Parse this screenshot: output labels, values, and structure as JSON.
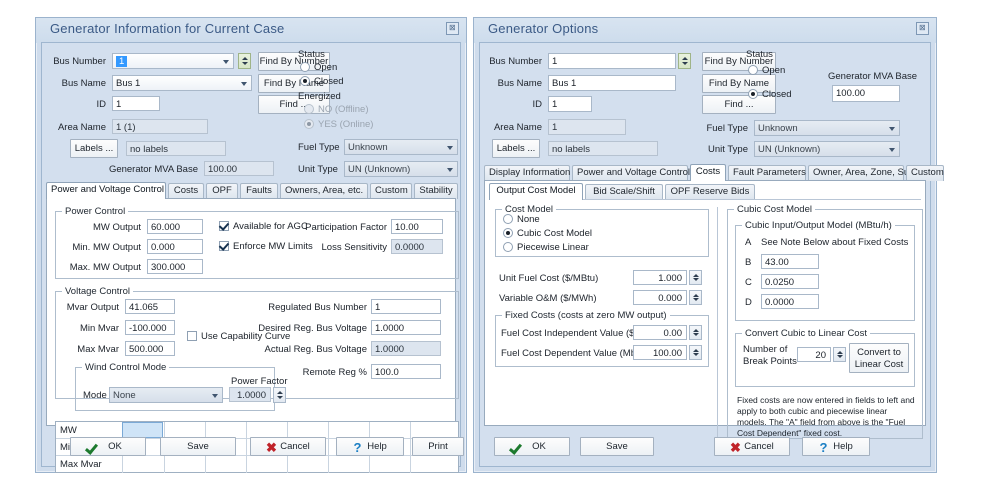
{
  "left_dialog": {
    "title": "Generator Information for Current Case",
    "close_label": "⊠",
    "fields": {
      "bus_number_label": "Bus Number",
      "bus_number_value": "1",
      "bus_name_label": "Bus Name",
      "bus_name_value": "Bus 1",
      "id_label": "ID",
      "id_value": "1",
      "area_name_label": "Area Name",
      "area_name_value": "1 (1)",
      "labels_button": "Labels ...",
      "labels_value": "no labels",
      "mva_base_label": "Generator MVA Base",
      "mva_base_value": "100.00",
      "fuel_type_label": "Fuel Type",
      "fuel_type_value": "Unknown",
      "unit_type_label": "Unit Type",
      "unit_type_value": "UN (Unknown)"
    },
    "find_buttons": {
      "find_by_number": "Find By Number",
      "find_by_name": "Find By Name",
      "find": "Find ..."
    },
    "status": {
      "group_label": "Status",
      "open_label": "Open",
      "closed_label": "Closed",
      "selected": "Closed",
      "energized_label": "Energized",
      "no_offline_label": "NO (Offline)",
      "yes_online_label": "YES (Online)",
      "energized_selected": "YES (Online)"
    },
    "tabs": [
      {
        "label": "Power and Voltage Control",
        "active": true
      },
      {
        "label": "Costs",
        "active": false
      },
      {
        "label": "OPF",
        "active": false
      },
      {
        "label": "Faults",
        "active": false
      },
      {
        "label": "Owners, Area, etc.",
        "active": false
      },
      {
        "label": "Custom",
        "active": false
      },
      {
        "label": "Stability",
        "active": false
      }
    ],
    "power_control": {
      "group_label": "Power Control",
      "mw_output_label": "MW Output",
      "mw_output_value": "60.000",
      "min_mw_label": "Min. MW Output",
      "min_mw_value": "0.000",
      "max_mw_label": "Max. MW Output",
      "max_mw_value": "300.000",
      "agc_label": "Available for AGC",
      "agc_checked": true,
      "enforce_label": "Enforce MW Limits",
      "enforce_checked": true,
      "participation_label": "Participation Factor",
      "participation_value": "10.00",
      "loss_sens_label": "Loss Sensitivity",
      "loss_sens_value": "0.0000"
    },
    "voltage_control": {
      "group_label": "Voltage Control",
      "mvar_output_label": "Mvar Output",
      "mvar_output_value": "41.065",
      "min_mvar_label": "Min Mvar",
      "min_mvar_value": "-100.000",
      "max_mvar_label": "Max Mvar",
      "max_mvar_value": "500.000",
      "capability_label": "Use Capability Curve",
      "capability_checked": false,
      "reg_bus_label": "Regulated Bus Number",
      "reg_bus_value": "1",
      "desired_volt_label": "Desired Reg. Bus Voltage",
      "desired_volt_value": "1.0000",
      "actual_volt_label": "Actual Reg. Bus Voltage",
      "actual_volt_value": "1.0000",
      "remote_reg_label": "Remote Reg %",
      "remote_reg_value": "100.0",
      "wind_group_label": "Wind Control Mode",
      "mode_label": "Mode",
      "mode_value": "None",
      "power_factor_label": "Power Factor",
      "power_factor_value": "1.0000"
    },
    "grid": {
      "rows": [
        "MW",
        "Min Mvar",
        "Max Mvar"
      ]
    },
    "buttons": [
      {
        "label": "OK",
        "icon": "check-icon"
      },
      {
        "label": "Save",
        "icon": ""
      },
      {
        "label": "Cancel",
        "icon": "x-icon"
      },
      {
        "label": "Help",
        "icon": "question-icon"
      },
      {
        "label": "Print",
        "icon": ""
      }
    ]
  },
  "right_dialog": {
    "title": "Generator Options",
    "close_label": "⊠",
    "fields": {
      "bus_number_label": "Bus Number",
      "bus_number_value": "1",
      "bus_name_label": "Bus Name",
      "bus_name_value": "Bus 1",
      "id_label": "ID",
      "id_value": "1",
      "area_name_label": "Area Name",
      "area_name_value": "1",
      "labels_button": "Labels ...",
      "labels_value": "no labels",
      "fuel_type_label": "Fuel Type",
      "fuel_type_value": "Unknown",
      "unit_type_label": "Unit Type",
      "unit_type_value": "UN (Unknown)",
      "mva_base_label": "Generator MVA Base",
      "mva_base_value": "100.00"
    },
    "find_buttons": {
      "find_by_number": "Find By Number",
      "find_by_name": "Find By Name",
      "find": "Find ..."
    },
    "status": {
      "group_label": "Status",
      "open_label": "Open",
      "closed_label": "Closed",
      "selected": "Closed"
    },
    "tabs": [
      {
        "label": "Display Information",
        "active": false
      },
      {
        "label": "Power and Voltage Control",
        "active": false
      },
      {
        "label": "Costs",
        "active": true
      },
      {
        "label": "Fault Parameters",
        "active": false
      },
      {
        "label": "Owner, Area, Zone, Sub",
        "active": false
      },
      {
        "label": "Custom",
        "active": false
      }
    ],
    "tab_scroll": {
      "left": "◄",
      "right": "►"
    },
    "subtabs": [
      {
        "label": "Output Cost Model",
        "active": true
      },
      {
        "label": "Bid Scale/Shift",
        "active": false
      },
      {
        "label": "OPF Reserve Bids",
        "active": false
      }
    ],
    "cost_model": {
      "group_label": "Cost Model",
      "none_label": "None",
      "cubic_label": "Cubic Cost Model",
      "piecewise_label": "Piecewise Linear",
      "selected": "Cubic Cost Model",
      "unit_fuel_label": "Unit Fuel Cost ($/MBtu)",
      "unit_fuel_value": "1.000",
      "variable_om_label": "Variable  O&M ($/MWh)",
      "variable_om_value": "0.000"
    },
    "fixed_costs": {
      "group_label": "Fixed Costs (costs at zero MW output)",
      "independent_label": "Fuel Cost Independent Value ($/hr)",
      "independent_value": "0.00",
      "dependent_label": "Fuel Cost Dependent Value (Mbtu/hr)",
      "dependent_value": "100.00"
    },
    "cubic": {
      "group_label": "Cubic Cost Model",
      "io_group_label": "Cubic Input/Output Model (MBtu/h)",
      "a_label": "A",
      "a_value": "See Note Below about Fixed Costs",
      "b_label": "B",
      "b_value": "43.00",
      "c_label": "C",
      "c_value": "0.0250",
      "d_label": "D",
      "d_value": "0.0000",
      "convert_group_label": "Convert Cubic to Linear Cost",
      "break_points_label": "Number of\nBreak Points",
      "break_points_label_1": "Number of",
      "break_points_label_2": "Break Points",
      "break_points_value": "20",
      "convert_button_1": "Convert to",
      "convert_button_2": "Linear Cost",
      "note": "Fixed costs are now entered in fields to left and apply to both cubic and piecewise linear models.  The \"A\" field from above is the \"Fuel Cost Dependent\" fixed cost."
    },
    "buttons": [
      {
        "label": "OK",
        "icon": "check-icon"
      },
      {
        "label": "Save",
        "icon": ""
      },
      {
        "label": "Cancel",
        "icon": "x-icon"
      },
      {
        "label": "Help",
        "icon": "question-icon"
      }
    ]
  },
  "page": {
    "caption": ""
  }
}
